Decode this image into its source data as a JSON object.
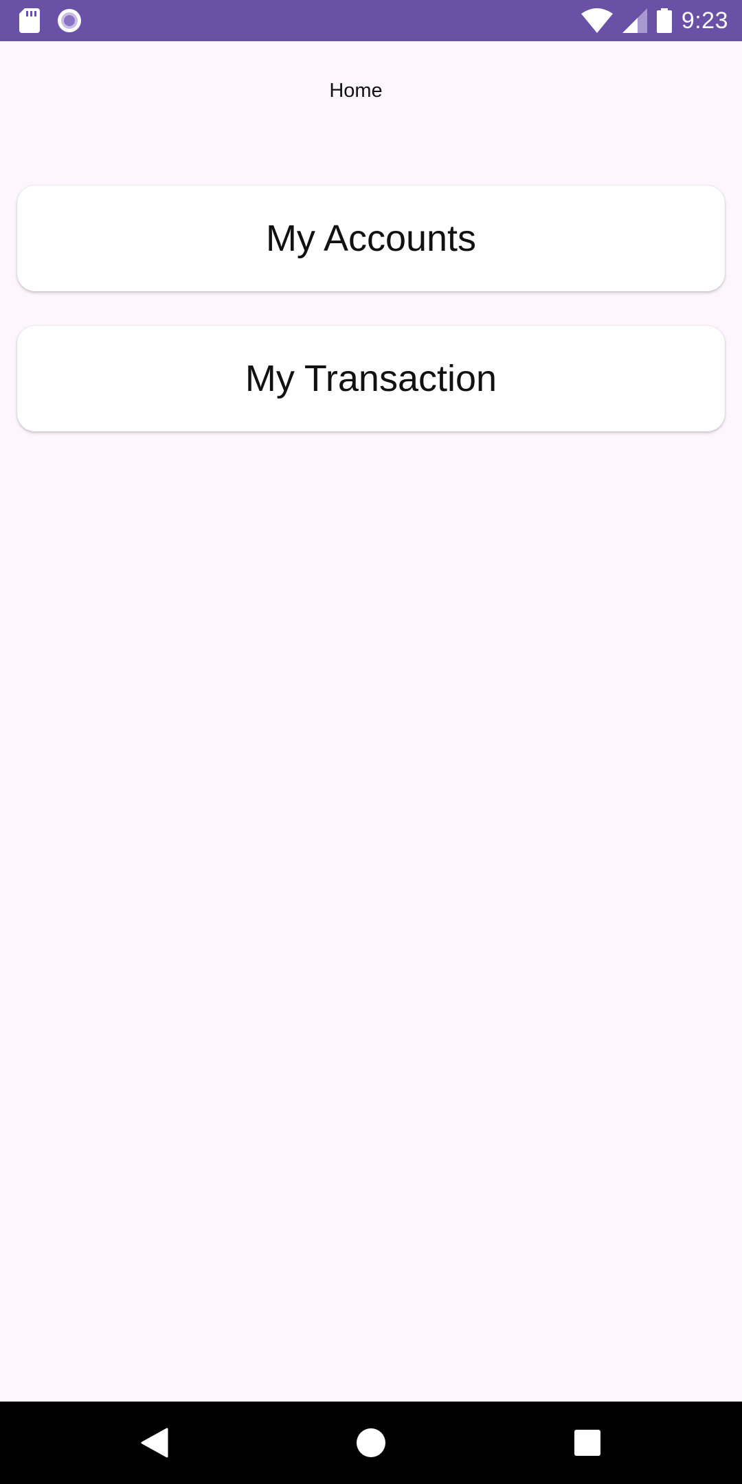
{
  "status_bar": {
    "time": "9:23",
    "left_icons": [
      "sd-card-icon",
      "record-circle-icon"
    ],
    "right_icons": [
      "wifi-icon",
      "cell-signal-icon",
      "battery-icon"
    ],
    "background_color": "#6951A5"
  },
  "header": {
    "title": "Home"
  },
  "menu": {
    "items": [
      {
        "label": "My Accounts"
      },
      {
        "label": "My Transaction"
      }
    ]
  },
  "nav_bar": {
    "buttons": [
      "back-icon",
      "home-icon",
      "recents-icon"
    ]
  },
  "colors": {
    "page_background": "#FDF7FD",
    "card_background": "#FFFFFF",
    "accent": "#6951A5"
  }
}
